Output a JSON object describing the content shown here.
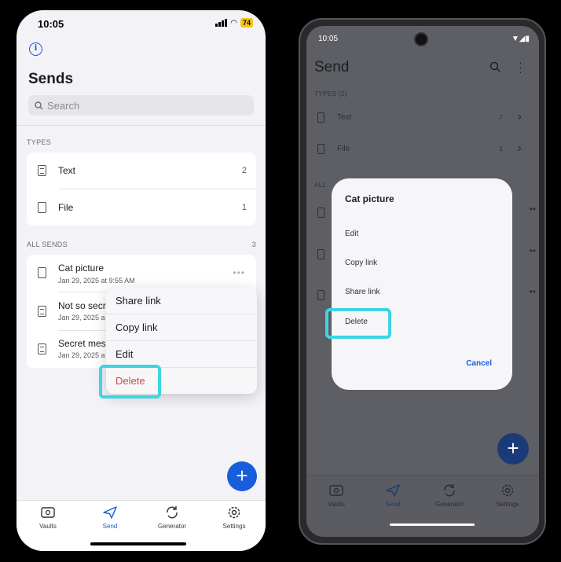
{
  "ios": {
    "status": {
      "time": "10:05",
      "battery": "74"
    },
    "title": "Sends",
    "search_placeholder": "Search",
    "types_label": "TYPES",
    "types": [
      {
        "label": "Text",
        "count": "2"
      },
      {
        "label": "File",
        "count": "1"
      }
    ],
    "all_sends_label": "ALL SENDS",
    "all_sends_count": "3",
    "sends": [
      {
        "name": "Cat picture",
        "date": "Jan 29, 2025 at 9:55 AM"
      },
      {
        "name": "Not so secr",
        "date": "Jan 29, 2025 a"
      },
      {
        "name": "Secret mes",
        "date": "Jan 29, 2025 a"
      }
    ],
    "context_menu": [
      "Share link",
      "Copy link",
      "Edit",
      "Delete"
    ],
    "fab_label": "+",
    "tabs": [
      "Vaults",
      "Send",
      "Generator",
      "Settings"
    ]
  },
  "android": {
    "status": {
      "time": "10:05"
    },
    "title": "Send",
    "types_label": "TYPES (2)",
    "types": [
      {
        "label": "Text",
        "count": "7"
      },
      {
        "label": "File",
        "count": "1"
      }
    ],
    "all_label": "ALL",
    "dialog": {
      "title": "Cat picture",
      "items": [
        "Edit",
        "Copy link",
        "Share link",
        "Delete"
      ],
      "cancel": "Cancel"
    },
    "fab_label": "+",
    "tabs": [
      "Vaults",
      "Send",
      "Generator",
      "Settings"
    ]
  },
  "colors": {
    "accent": "#175ddc",
    "highlight": "#3fd4e2",
    "danger": "#e0453a"
  }
}
